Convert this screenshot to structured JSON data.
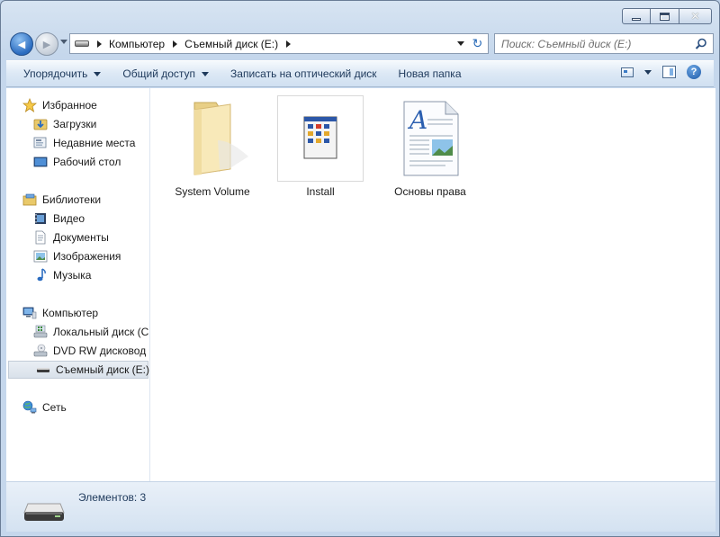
{
  "window": {
    "caption_buttons": {
      "minimize": "minimize",
      "maximize": "maximize",
      "close": "✕"
    }
  },
  "navigation": {
    "back_glyph": "◀",
    "forward_glyph": "▶",
    "breadcrumbs": [
      "Компьютер",
      "Съемный диск (E:)"
    ],
    "refresh_glyph": "↻",
    "search_placeholder": "Поиск: Съемный диск (E:)"
  },
  "toolbar": {
    "organize": "Упорядочить",
    "share": "Общий доступ",
    "burn": "Записать на оптический диск",
    "new_folder": "Новая папка",
    "help": "?"
  },
  "sidebar": {
    "favorites": {
      "label": "Избранное",
      "items": [
        "Загрузки",
        "Недавние места",
        "Рабочий стол"
      ]
    },
    "libraries": {
      "label": "Библиотеки",
      "items": [
        "Видео",
        "Документы",
        "Изображения",
        "Музыка"
      ]
    },
    "computer": {
      "label": "Компьютер",
      "items": [
        "Локальный диск (C:)",
        "DVD RW дисковод (D:)",
        "Съемный диск (E:)"
      ],
      "selected_index": 2
    },
    "network": {
      "label": "Сеть"
    }
  },
  "files": [
    {
      "name": "System Volume",
      "type": "folder"
    },
    {
      "name": "Install",
      "type": "application"
    },
    {
      "name": "Основы права",
      "type": "document"
    }
  ],
  "details": {
    "count_text": "Элементов: 3"
  },
  "colors": {
    "accent": "#1e395b",
    "window_frame": "#c5d7ec",
    "selection": "#d9e1ea"
  }
}
